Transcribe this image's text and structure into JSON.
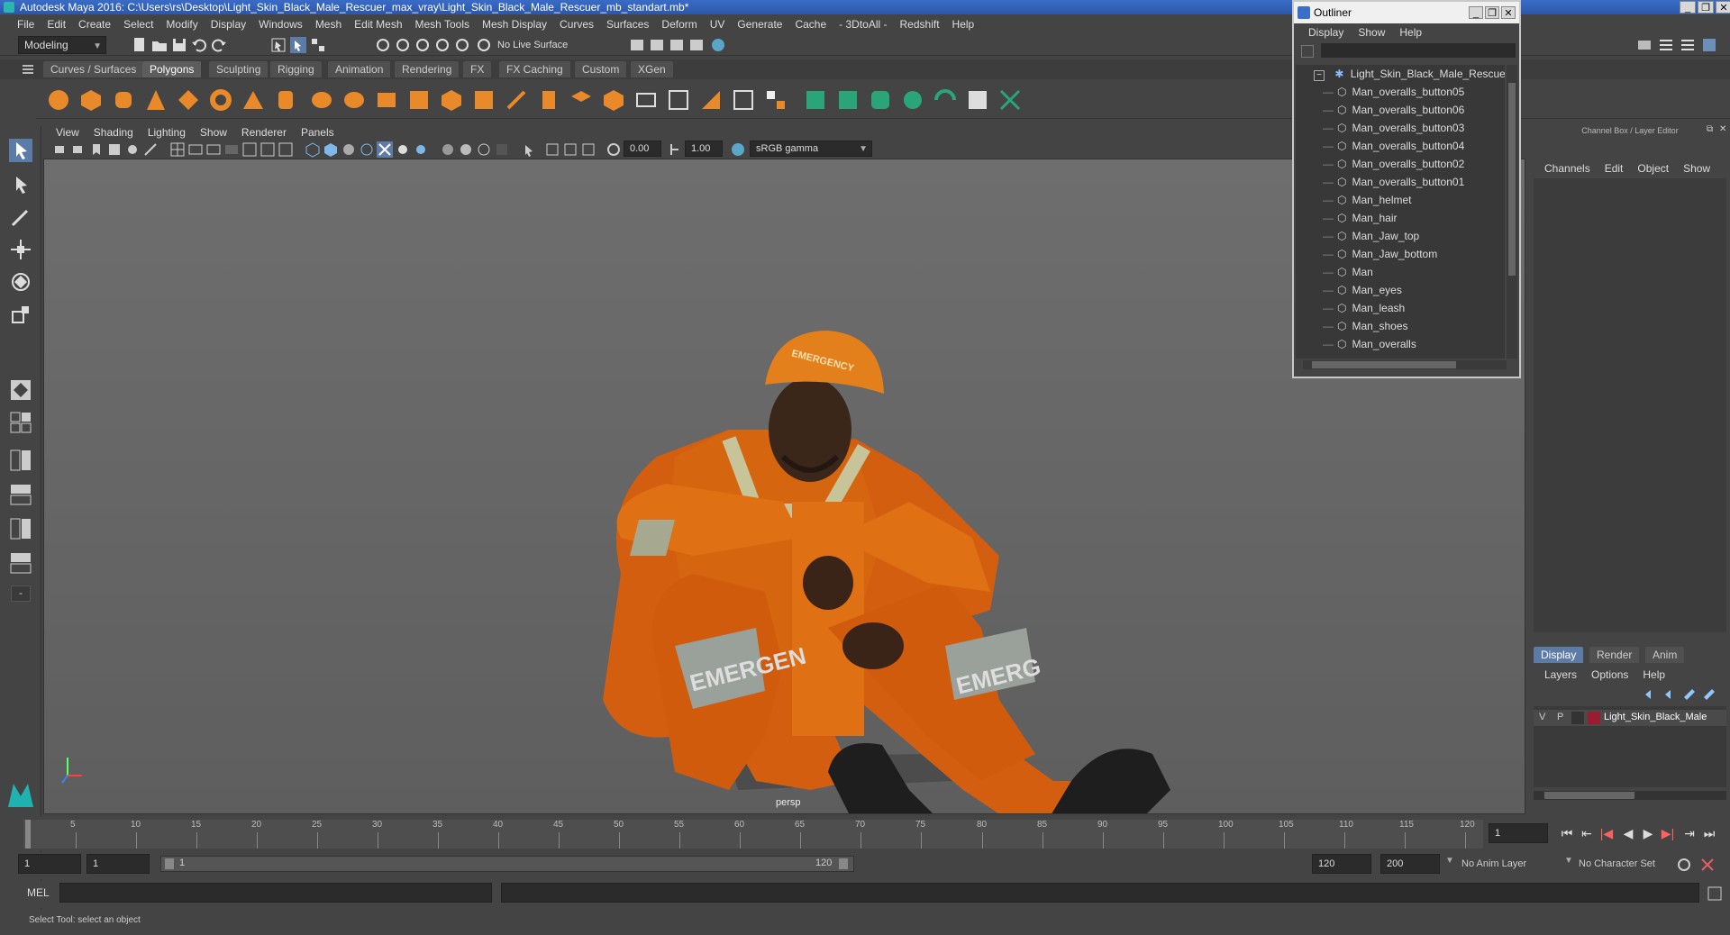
{
  "window": {
    "title": "Autodesk Maya 2016: C:\\Users\\rs\\Desktop\\Light_Skin_Black_Male_Rescuer_max_vray\\Light_Skin_Black_Male_Rescuer_mb_standart.mb*",
    "minimize": "_",
    "restore": "❐",
    "close": "✕"
  },
  "menubar": [
    "File",
    "Edit",
    "Create",
    "Select",
    "Modify",
    "Display",
    "Windows",
    "Mesh",
    "Edit Mesh",
    "Mesh Tools",
    "Mesh Display",
    "Curves",
    "Surfaces",
    "Deform",
    "UV",
    "Generate",
    "Cache",
    "- 3DtoAll -",
    "Redshift",
    "Help"
  ],
  "statusline": {
    "mode": "Modeling",
    "live_surface": "No Live Surface"
  },
  "shelf": {
    "tabs": [
      "Curves / Surfaces",
      "Polygons",
      "Sculpting",
      "Rigging",
      "Animation",
      "Rendering",
      "FX",
      "FX Caching",
      "Custom",
      "XGen"
    ],
    "active_tab": "Polygons"
  },
  "viewport": {
    "menu": [
      "View",
      "Shading",
      "Lighting",
      "Show",
      "Renderer",
      "Panels"
    ],
    "exposure": "0.00",
    "gamma": "1.00",
    "color_space": "sRGB gamma",
    "camera_label": "persp",
    "helmet_text": "EMERGENCY",
    "left_leg_text": "EMERGEN",
    "right_leg_text": "EMERG"
  },
  "outliner": {
    "title": "Outliner",
    "menu": [
      "Display",
      "Show",
      "Help"
    ],
    "root": "Light_Skin_Black_Male_Rescuer_r",
    "items": [
      "Man_overalls_button05",
      "Man_overalls_button06",
      "Man_overalls_button03",
      "Man_overalls_button04",
      "Man_overalls_button02",
      "Man_overalls_button01",
      "Man_helmet",
      "Man_hair",
      "Man_Jaw_top",
      "Man_Jaw_bottom",
      "Man",
      "Man_eyes",
      "Man_leash",
      "Man_shoes",
      "Man_overalls"
    ]
  },
  "channelbox": {
    "title": "Channel Box / Layer Editor",
    "menu": [
      "Channels",
      "Edit",
      "Object",
      "Show"
    ],
    "layer_tabs": [
      "Display",
      "Render",
      "Anim"
    ],
    "active_layer_tab": "Display",
    "layer_menu": [
      "Layers",
      "Options",
      "Help"
    ],
    "layer": {
      "v": "V",
      "p": "P",
      "name": "Light_Skin_Black_Male",
      "color": "#9b1b30"
    }
  },
  "timeline": {
    "ticks": [
      "5",
      "10",
      "15",
      "20",
      "25",
      "30",
      "35",
      "40",
      "45",
      "50",
      "55",
      "60",
      "65",
      "70",
      "75",
      "80",
      "85",
      "90",
      "95",
      "100",
      "105",
      "110",
      "115",
      "120"
    ],
    "first_tick": "1",
    "current_frame": "1"
  },
  "range": {
    "start": "1",
    "start2": "1",
    "slider_start": "1",
    "slider_end": "120",
    "end": "120",
    "end2": "200",
    "anim_layer": "No Anim Layer",
    "character_set": "No Character Set"
  },
  "cmdline": {
    "label": "MEL"
  },
  "helpline": {
    "text": "Select Tool: select an object"
  }
}
